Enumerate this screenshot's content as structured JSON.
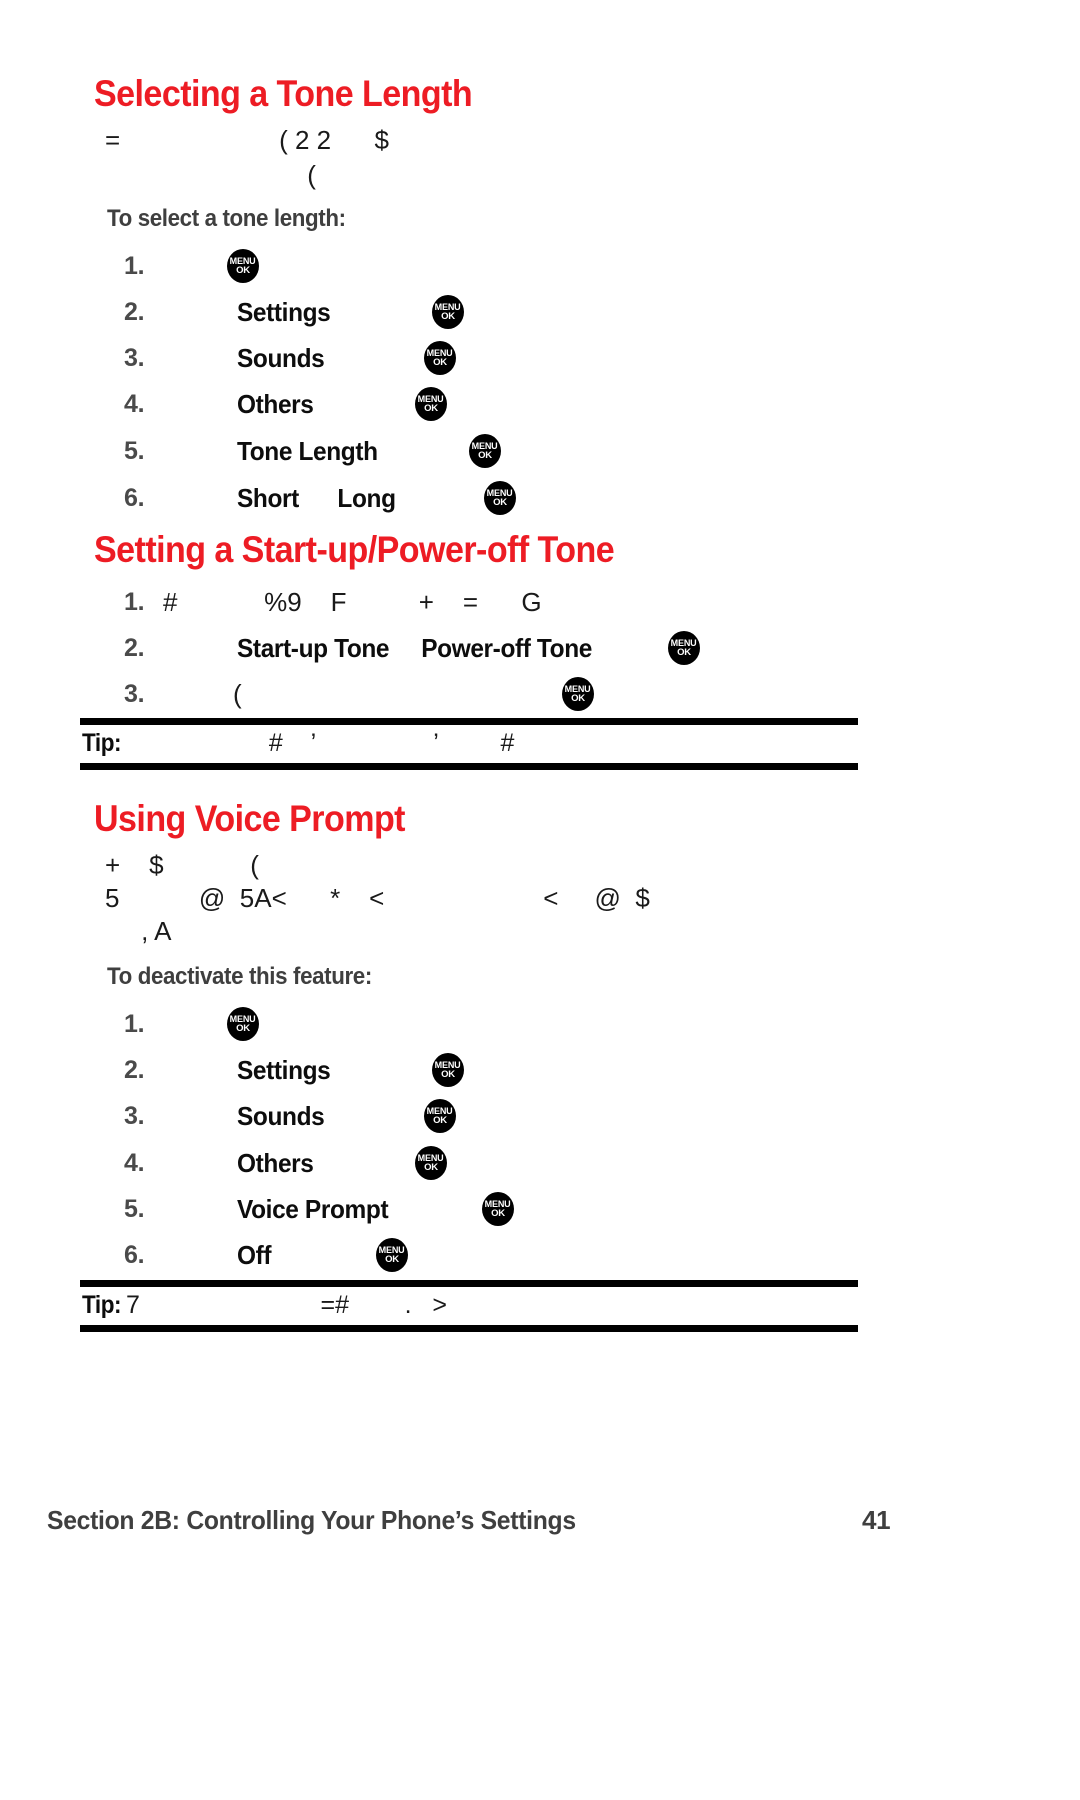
{
  "page": {
    "background_color": "#ffffff",
    "accent_color": "#ed1c24",
    "body_color": "#231f20"
  },
  "sections": [
    {
      "heading": "Selecting a Tone Length",
      "intro_lines": [
        "=                      ( 2 2      $",
        "                            ("
      ],
      "subheading": "To select a tone length:",
      "steps": [
        {
          "num": "1.",
          "text": "",
          "key": "MENU OK"
        },
        {
          "num": "2.",
          "text": "Settings",
          "key": "MENU OK"
        },
        {
          "num": "3.",
          "text": "Sounds",
          "key": "MENU OK"
        },
        {
          "num": "4.",
          "text": "Others",
          "key": "MENU OK"
        },
        {
          "num": "5.",
          "text": "Tone Length",
          "key": "MENU OK"
        },
        {
          "num": "6.",
          "text": "Short      Long",
          "key": "MENU OK"
        }
      ]
    },
    {
      "heading": "Setting a Start-up/Power-off Tone",
      "steps": [
        {
          "num": "1.",
          "text": "#            %9    F          +    =      G",
          "key": ""
        },
        {
          "num": "2.",
          "text": "Start-up Tone     Power-off Tone",
          "key": "MENU OK"
        },
        {
          "num": "3.",
          "text": "(",
          "key": "MENU OK"
        }
      ],
      "tip": {
        "label": "Tip:",
        "text": "                    #    ’                 ’         #"
      }
    },
    {
      "heading": "Using Voice Prompt",
      "intro_lines": [
        "+    $            (",
        "5           @  5A<      *    <                      <     @  $",
        "     , A"
      ],
      "subheading": "To deactivate this feature:",
      "steps": [
        {
          "num": "1.",
          "text": "",
          "key": "MENU OK"
        },
        {
          "num": "2.",
          "text": "Settings",
          "key": "MENU OK"
        },
        {
          "num": "3.",
          "text": "Sounds",
          "key": "MENU OK"
        },
        {
          "num": "4.",
          "text": "Others",
          "key": "MENU OK"
        },
        {
          "num": "5.",
          "text": "Voice Prompt",
          "key": "MENU OK"
        },
        {
          "num": "6.",
          "text": "Off",
          "key": "MENU OK"
        }
      ],
      "tip": {
        "label": "Tip:",
        "text": "7                          =#        .   >"
      }
    }
  ],
  "menu_key": {
    "top": "MENU",
    "bottom": "OK"
  },
  "footer": {
    "section_text": "Section 2B: Controlling Your Phone’s Settings",
    "page_number": "41"
  }
}
